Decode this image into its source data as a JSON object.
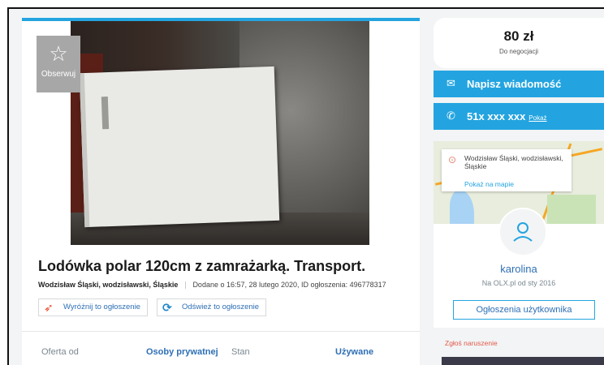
{
  "observe": {
    "label": "Obserwuj",
    "icon": "star-icon"
  },
  "listing": {
    "title": "Lodówka polar 120cm z zamrażarką. Transport.",
    "location": "Wodzisław Śląski, wodzisławski, Śląskie",
    "added": "Dodane o 16:57, 28 lutego 2020, ID ogłoszenia: 496778317"
  },
  "promos": [
    {
      "label": "Wyróżnij to ogłoszenie",
      "icon": "kite-icon"
    },
    {
      "label": "Odśwież to ogłoszenie",
      "icon": "refresh-icon"
    }
  ],
  "specs": [
    {
      "key": "Oferta od",
      "value": "Osoby prywatnej"
    },
    {
      "key": "Stan",
      "value": "Używane"
    }
  ],
  "price": {
    "amount": "80 zł",
    "note": "Do negocjacji"
  },
  "contact": {
    "message_label": "Napisz wiadomość",
    "phone_masked": "51x xxx xxx",
    "phone_show": "Pokaż"
  },
  "map": {
    "address": "Wodzisław Śląski, wodzisławski, Śląskie",
    "show_on_map": "Pokaż na mapie"
  },
  "user": {
    "name": "karolina",
    "since": "Na OLX.pl od sty 2016",
    "ads_button": "Ogłoszenia użytkownika"
  },
  "report": "Zgłoś naruszenie",
  "colors": {
    "accent": "#23a4e0",
    "link": "#2e6fb5",
    "report": "#e35a4a"
  }
}
